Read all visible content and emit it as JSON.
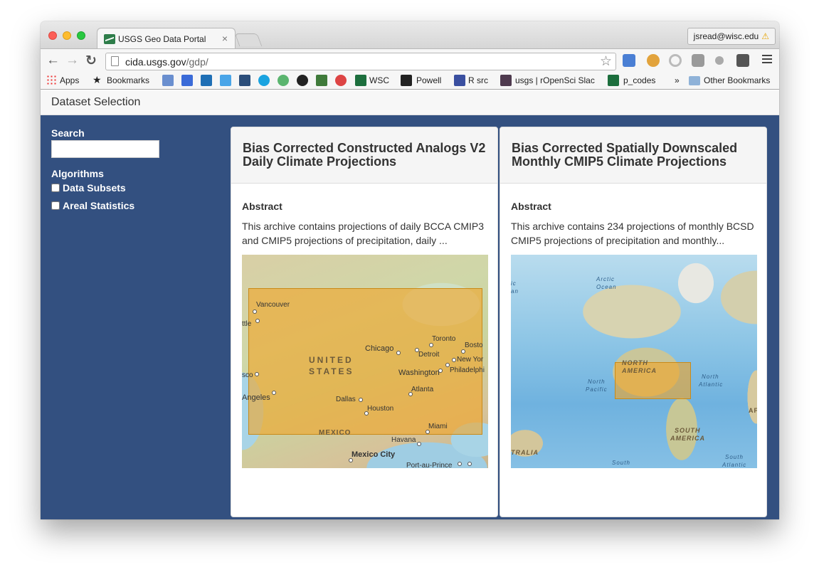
{
  "browser": {
    "tab_title": "USGS Geo Data Portal",
    "tab_close": "×",
    "profile_email": "jsread@wisc.edu",
    "profile_warning": "⚠",
    "url_host": "cida.usgs.gov",
    "url_path": "/gdp/",
    "star": "☆",
    "back": "←",
    "forward": "→",
    "reload": "↻"
  },
  "bookmarks": {
    "apps": "Apps",
    "bookmarks": "Bookmarks",
    "wsc": "WSC",
    "powell": "Powell",
    "r_src": "R src",
    "rosci": "usgs | rOpenSci Slac",
    "p_codes": "p_codes",
    "more": "»",
    "other": "Other Bookmarks"
  },
  "page": {
    "title": "Dataset Selection"
  },
  "sidebar": {
    "search_label": "Search",
    "search_value": "",
    "algorithms_label": "Algorithms",
    "options": [
      "Data Subsets",
      "Areal Statistics"
    ]
  },
  "cards": [
    {
      "title": "Bias Corrected Constructed Analogs V2 Daily Climate Projections",
      "abstract_label": "Abstract",
      "abstract": "This archive contains projections of daily BCCA CMIP3 and CMIP5 projections of precipitation, daily ...",
      "map_labels": {
        "vancouver": "Vancouver",
        "seattle": "ttle",
        "toronto": "Toronto",
        "boston": "Bosto",
        "chicago": "Chicago",
        "detroit": "Detroit",
        "newyork": "New Yor",
        "united": "UNITED",
        "states": "STATES",
        "washington": "Washington",
        "philadelphia": "Philadelphi",
        "sanfran": "sco",
        "losangeles": "Angeles",
        "atlanta": "Atlanta",
        "dallas": "Dallas",
        "houston": "Houston",
        "mexico": "MEXICO",
        "miami": "Miami",
        "havana": "Havana",
        "mexicocity": "Mexico City",
        "portauprince": "Port-au-Prince"
      }
    },
    {
      "title": "Bias Corrected Spatially Downscaled Monthly CMIP5 Climate Projections",
      "abstract_label": "Abstract",
      "abstract": "This archive contains 234 projections of monthly BCSD CMIP5 projections of precipitation and monthly...",
      "map_labels": {
        "arctic": "Arctic",
        "ocean": "Ocean",
        "ic": "ic",
        "an": "an",
        "north": "NORTH",
        "america": "AMERICA",
        "np_north": "North",
        "np_pacific": "Pacific",
        "na_north": "North",
        "na_atlantic": "Atlantic",
        "south": "SOUTH",
        "samerica": "AMERICA",
        "af": "AF",
        "tralia": "TRALIA",
        "south_label": "South",
        "sa_south": "South",
        "sa_atlantic": "Atlantic"
      }
    }
  ],
  "colors": {
    "page_bg": "#335080",
    "bbox": "#f0a528"
  }
}
